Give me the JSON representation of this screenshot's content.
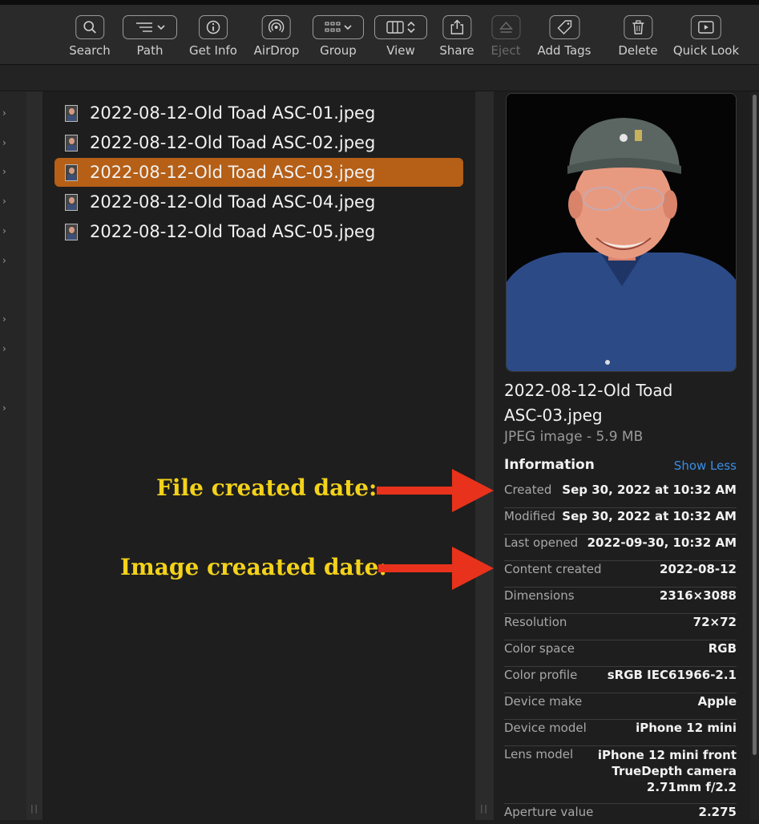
{
  "toolbar": {
    "items": [
      {
        "label": "Search",
        "icon": "search-icon"
      },
      {
        "label": "Path",
        "icon": "list-icon"
      },
      {
        "label": "Get Info",
        "icon": "info-icon"
      },
      {
        "label": "AirDrop",
        "icon": "airdrop-icon"
      },
      {
        "label": "Group",
        "icon": "grid-icon"
      },
      {
        "label": "View",
        "icon": "columns-icon"
      },
      {
        "label": "Share",
        "icon": "share-icon"
      },
      {
        "label": "Eject",
        "icon": "eject-icon",
        "disabled": true
      },
      {
        "label": "Add Tags",
        "icon": "tag-icon"
      },
      {
        "label": "Delete",
        "icon": "trash-icon"
      },
      {
        "label": "Quick Look",
        "icon": "play-icon"
      }
    ]
  },
  "files": [
    {
      "name": "2022-08-12-Old Toad ASC-01.jpeg",
      "selected": false
    },
    {
      "name": "2022-08-12-Old Toad ASC-02.jpeg",
      "selected": false
    },
    {
      "name": "2022-08-12-Old Toad ASC-03.jpeg",
      "selected": true
    },
    {
      "name": "2022-08-12-Old Toad ASC-04.jpeg",
      "selected": false
    },
    {
      "name": "2022-08-12-Old Toad ASC-05.jpeg",
      "selected": false
    }
  ],
  "preview": {
    "filename_line1": "2022-08-12-Old Toad",
    "filename_line2": "ASC-03.jpeg",
    "filetype": "JPEG image - 5.9 MB",
    "info_header": "Information",
    "show_less": "Show Less",
    "info": [
      {
        "key": "Created",
        "value": "Sep 30, 2022 at 10:32 AM"
      },
      {
        "key": "Modified",
        "value": "Sep 30, 2022 at 10:32 AM"
      },
      {
        "key": "Last opened",
        "value": "2022-09-30, 10:32 AM"
      },
      {
        "key": "Content created",
        "value": "2022-08-12"
      },
      {
        "key": "Dimensions",
        "value": "2316×3088"
      },
      {
        "key": "Resolution",
        "value": "72×72"
      },
      {
        "key": "Color space",
        "value": "RGB"
      },
      {
        "key": "Color profile",
        "value": "sRGB IEC61966-2.1"
      },
      {
        "key": "Device make",
        "value": "Apple"
      },
      {
        "key": "Device model",
        "value": "iPhone 12 mini"
      },
      {
        "key": "Lens model",
        "value": "iPhone 12 mini front\nTrueDepth camera\n2.71mm f/2.2"
      },
      {
        "key": "Aperture value",
        "value": "2.275"
      }
    ]
  },
  "annotations": {
    "file_created": "File created date:",
    "image_created": "Image creaated date:"
  },
  "colors": {
    "selection": "#b55f17",
    "annotation_text": "#f3d21a",
    "arrow": "#e8321c",
    "link": "#3a8ee6"
  }
}
